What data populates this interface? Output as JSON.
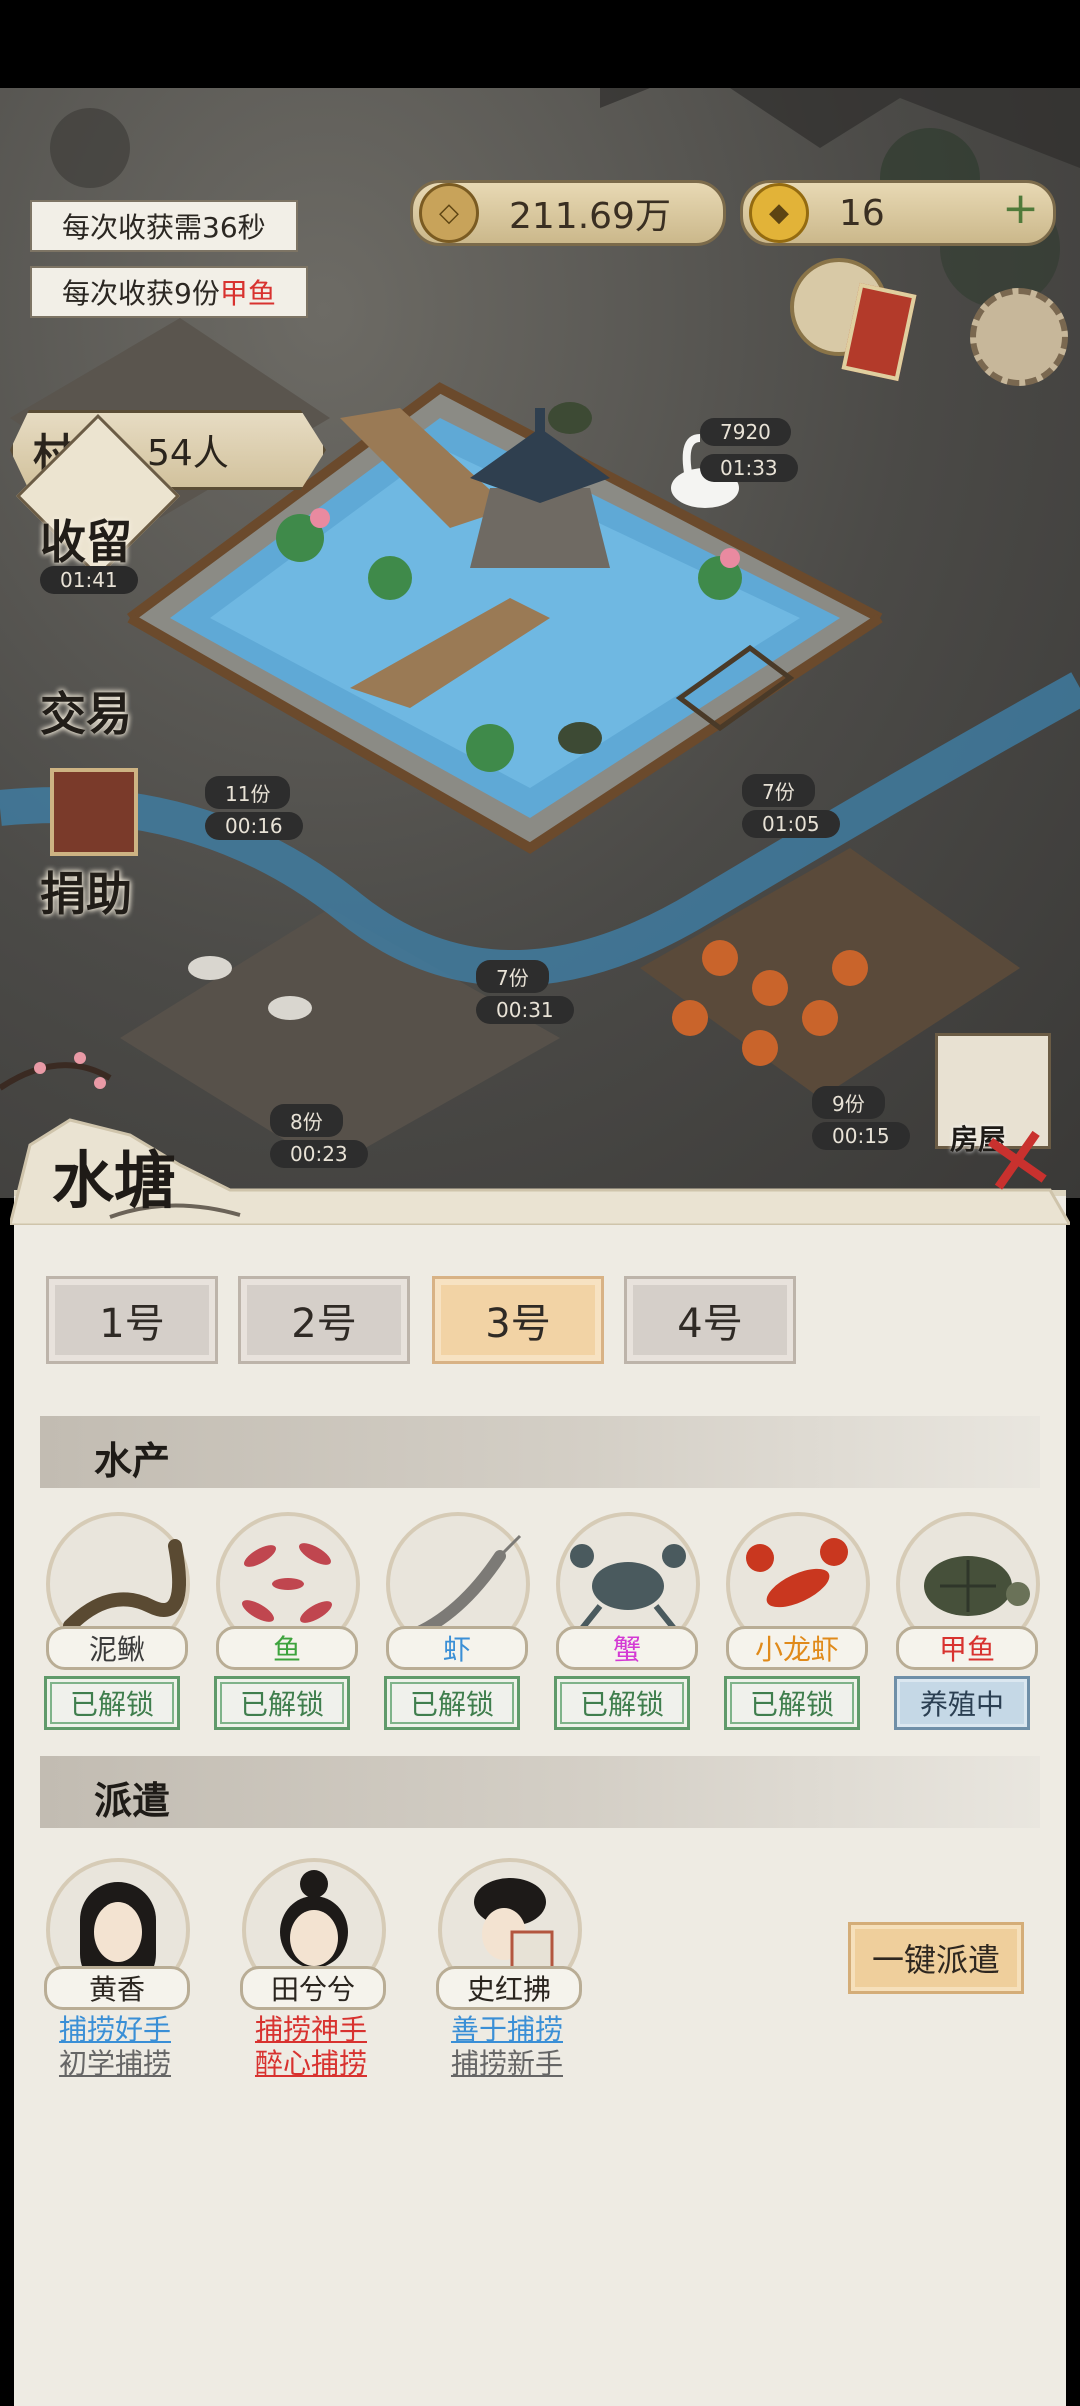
{
  "hud": {
    "harvest_time": "每次收获需36秒",
    "harvest_amount_prefix": "每次收获9份",
    "harvest_amount_item": "甲鱼",
    "copper": "211.69万",
    "gold": "16",
    "villagers_label": "村民",
    "villagers_count": "54人"
  },
  "side_buttons": {
    "shelter": "收留",
    "shelter_timer": "01:41",
    "trade": "交易",
    "donate": "捐助",
    "house": "房屋"
  },
  "map_timers": [
    {
      "amount": "7920",
      "time": "01:33"
    },
    {
      "amount": "11份",
      "time": "00:16"
    },
    {
      "amount": "7份",
      "time": "01:05"
    },
    {
      "amount": "7份",
      "time": "00:31"
    },
    {
      "amount": "8份",
      "time": "00:23"
    },
    {
      "amount": "9份",
      "time": "00:15"
    }
  ],
  "panel": {
    "title": "水塘",
    "tabs": [
      "1号",
      "2号",
      "3号",
      "4号"
    ],
    "active_tab": "3号",
    "section_aquatic": "水产",
    "section_dispatch": "派遣",
    "dispatch_all": "一键派遣"
  },
  "aquatic": [
    {
      "name": "泥鳅",
      "status": "已解锁",
      "color": "#3c3c3c",
      "icon": "loach-icon"
    },
    {
      "name": "鱼",
      "status": "已解锁",
      "color": "#3da33d",
      "icon": "fish-icon"
    },
    {
      "name": "虾",
      "status": "已解锁",
      "color": "#3a8fd6",
      "icon": "shrimp-icon"
    },
    {
      "name": "蟹",
      "status": "已解锁",
      "color": "#d43ad4",
      "icon": "crab-icon"
    },
    {
      "name": "小龙虾",
      "status": "已解锁",
      "color": "#e08a1a",
      "icon": "crayfish-icon"
    },
    {
      "name": "甲鱼",
      "status": "养殖中",
      "color": "#d8322f",
      "icon": "turtle-icon"
    }
  ],
  "workers": [
    {
      "name": "黄香",
      "trait1": "捕捞好手",
      "trait1_color": "#3a8fd6",
      "trait2": "初学捕捞",
      "trait2_color": "#666666"
    },
    {
      "name": "田兮兮",
      "trait1": "捕捞神手",
      "trait1_color": "#d8322f",
      "trait2": "醉心捕捞",
      "trait2_color": "#d8322f"
    },
    {
      "name": "史红拂",
      "trait1": "善于捕捞",
      "trait1_color": "#3a8fd6",
      "trait2": "捕捞新手",
      "trait2_color": "#666666"
    }
  ]
}
